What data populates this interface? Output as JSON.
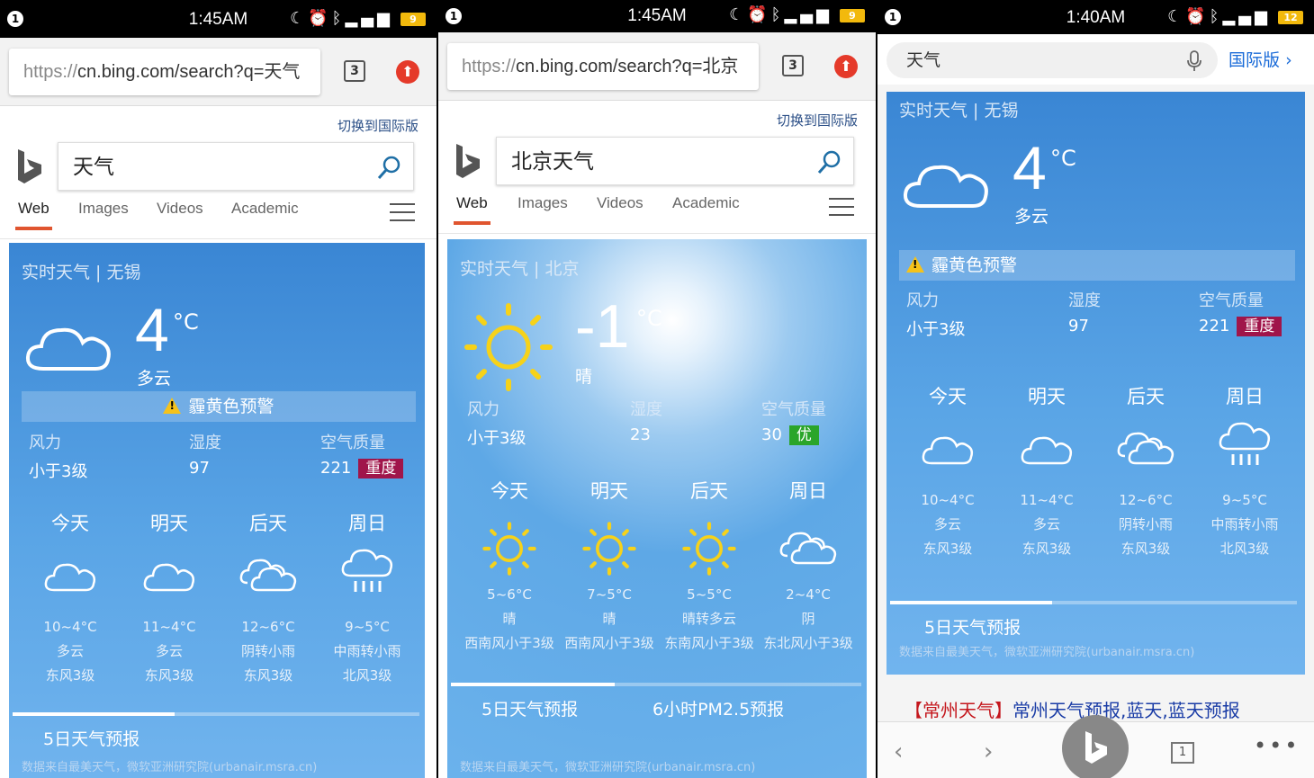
{
  "screens": [
    {
      "status": {
        "time": "1:45AM",
        "battery": "9"
      },
      "url": {
        "prefix": "https://",
        "domain": "cn.bing.com/search?q=天气"
      },
      "tab_count": "3",
      "switch_link": "切换到国际版",
      "query": "天气",
      "nav": [
        "Web",
        "Images",
        "Videos",
        "Academic"
      ],
      "weather": {
        "title": "实时天气 | 无锡",
        "temp": "4",
        "unit": "°C",
        "condition": "多云",
        "alert": "霾黄色预警",
        "wind_label": "风力",
        "wind_value": "小于3级",
        "humidity_label": "湿度",
        "humidity_value": "97",
        "aqi_label": "空气质量",
        "aqi_value": "221",
        "aqi_level": "重度",
        "forecast": [
          {
            "day": "今天",
            "icon": "cloud-icon",
            "temp": "10~4°C",
            "cond": "多云",
            "wind": "东风3级"
          },
          {
            "day": "明天",
            "icon": "cloud-icon",
            "temp": "11~4°C",
            "cond": "多云",
            "wind": "东风3级"
          },
          {
            "day": "后天",
            "icon": "cloud-rain-light-icon",
            "temp": "12~6°C",
            "cond": "阴转小雨",
            "wind": "东风3级"
          },
          {
            "day": "周日",
            "icon": "rain-icon",
            "temp": "9~5°C",
            "cond": "中雨转小雨",
            "wind": "北风3级"
          }
        ],
        "tabs": [
          "5日天气预报"
        ],
        "source": "数据来自最美天气，微软亚洲研究院(urbanair.msra.cn)"
      }
    },
    {
      "status": {
        "time": "1:45AM",
        "battery": "9"
      },
      "url": {
        "prefix": "https://",
        "domain": "cn.bing.com/search?q=北京"
      },
      "tab_count": "3",
      "switch_link": "切换到国际版",
      "query": "北京天气",
      "nav": [
        "Web",
        "Images",
        "Videos",
        "Academic"
      ],
      "weather": {
        "title": "实时天气 | 北京",
        "temp": "-1",
        "unit": "°C",
        "condition": "晴",
        "wind_label": "风力",
        "wind_value": "小于3级",
        "humidity_label": "湿度",
        "humidity_value": "23",
        "aqi_label": "空气质量",
        "aqi_value": "30",
        "aqi_level": "优",
        "forecast": [
          {
            "day": "今天",
            "icon": "sun-icon",
            "temp": "5~6°C",
            "cond": "晴",
            "wind": "西南风小于3级"
          },
          {
            "day": "明天",
            "icon": "sun-icon",
            "temp": "7~5°C",
            "cond": "晴",
            "wind": "西南风小于3级"
          },
          {
            "day": "后天",
            "icon": "sun-icon",
            "temp": "5~5°C",
            "cond": "晴转多云",
            "wind": "东南风小于3级"
          },
          {
            "day": "周日",
            "icon": "cloud-icon",
            "temp": "2~4°C",
            "cond": "阴",
            "wind": "东北风小于3级"
          }
        ],
        "tabs": [
          "5日天气预报",
          "6小时PM2.5预报"
        ],
        "source": "数据来自最美天气，微软亚洲研究院(urbanair.msra.cn)"
      }
    },
    {
      "status": {
        "time": "1:40AM",
        "battery": "12"
      },
      "query": "天气",
      "intl_link": "国际版",
      "weather": {
        "title": "实时天气 | 无锡",
        "temp": "4",
        "unit": "°C",
        "condition": "多云",
        "alert": "霾黄色预警",
        "wind_label": "风力",
        "wind_value": "小于3级",
        "humidity_label": "湿度",
        "humidity_value": "97",
        "aqi_label": "空气质量",
        "aqi_value": "221",
        "aqi_level": "重度",
        "forecast": [
          {
            "day": "今天",
            "icon": "cloud-icon",
            "temp": "10~4°C",
            "cond": "多云",
            "wind": "东风3级"
          },
          {
            "day": "明天",
            "icon": "cloud-icon",
            "temp": "11~4°C",
            "cond": "多云",
            "wind": "东风3级"
          },
          {
            "day": "后天",
            "icon": "cloud-rain-light-icon",
            "temp": "12~6°C",
            "cond": "阴转小雨",
            "wind": "东风3级"
          },
          {
            "day": "周日",
            "icon": "rain-icon",
            "temp": "9~5°C",
            "cond": "中雨转小雨",
            "wind": "北风3级"
          }
        ],
        "tabs": [
          "5日天气预报"
        ],
        "source": "数据来自最美天气，微软亚洲研究院(urbanair.msra.cn)"
      },
      "result_link": {
        "bracket": "【常州天气】",
        "rest": "常州天气预报,蓝天,蓝天预报"
      },
      "bottom": {
        "tab_count": "1"
      }
    }
  ],
  "colors": {
    "bing_accent": "#e0552f",
    "alert_yellow": "#f5c21b",
    "severe": "#a0154a",
    "good": "#2aa52a",
    "link_blue": "#1a6bd8"
  }
}
